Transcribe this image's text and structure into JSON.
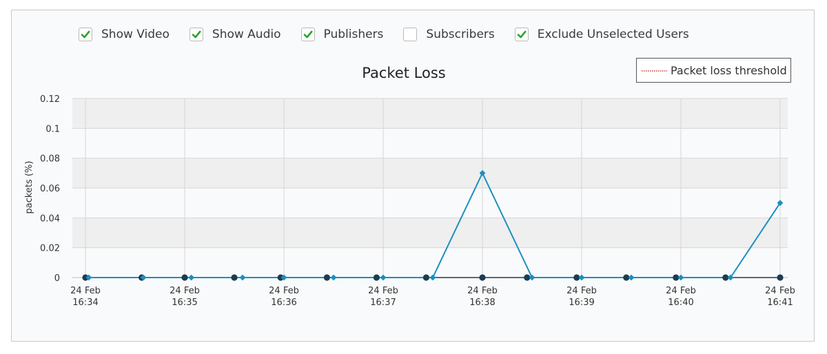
{
  "filters": [
    {
      "label": "Show Video",
      "checked": true
    },
    {
      "label": "Show Audio",
      "checked": true
    },
    {
      "label": "Publishers",
      "checked": true
    },
    {
      "label": "Subscribers",
      "checked": false
    },
    {
      "label": "Exclude Unselected Users",
      "checked": true
    }
  ],
  "colors": {
    "check": "#2ca12c",
    "series_a": "#1a8fc0",
    "series_b": "#1c3d4f",
    "threshold": "#c0392b",
    "band": "#efefef",
    "grid": "#d6d6d6"
  },
  "chart_data": {
    "type": "line",
    "title": "Packet Loss",
    "ylabel": "packets (%)",
    "xlabel": "",
    "ylim": [
      0,
      0.12
    ],
    "yticks": [
      "0",
      "0.02",
      "0.04",
      "0.06",
      "0.08",
      "0.1",
      "0.12"
    ],
    "xticks": [
      [
        "24 Feb",
        "16:34"
      ],
      [
        "24 Feb",
        "16:35"
      ],
      [
        "24 Feb",
        "16:36"
      ],
      [
        "24 Feb",
        "16:37"
      ],
      [
        "24 Feb",
        "16:38"
      ],
      [
        "24 Feb",
        "16:39"
      ],
      [
        "24 Feb",
        "16:40"
      ],
      [
        "24 Feb",
        "16:41"
      ]
    ],
    "legend": {
      "label": "Packet loss threshold",
      "placement": "top-right"
    },
    "grid": true,
    "series": [
      {
        "marker": "diamond",
        "x": [
          "16:34:02",
          "16:34:35",
          "16:35:04",
          "16:35:35",
          "16:36:00",
          "16:36:30",
          "16:37:00",
          "16:37:30",
          "16:38:00",
          "16:38:30",
          "16:39:00",
          "16:39:30",
          "16:40:00",
          "16:40:30",
          "16:41:00"
        ],
        "values": [
          0,
          0,
          0,
          0,
          0,
          0,
          0,
          0,
          0.07,
          0,
          0,
          0,
          0,
          0,
          0.05
        ]
      },
      {
        "marker": "circle",
        "x": [
          "16:34:00",
          "16:34:34",
          "16:35:00",
          "16:35:30",
          "16:35:58",
          "16:36:26",
          "16:36:56",
          "16:37:26",
          "16:38:00",
          "16:38:27",
          "16:38:57",
          "16:39:27",
          "16:39:57",
          "16:40:27",
          "16:41:00"
        ],
        "values": [
          0,
          0,
          0,
          0,
          0,
          0,
          0,
          0,
          0,
          0,
          0,
          0,
          0,
          0,
          0
        ]
      }
    ]
  }
}
